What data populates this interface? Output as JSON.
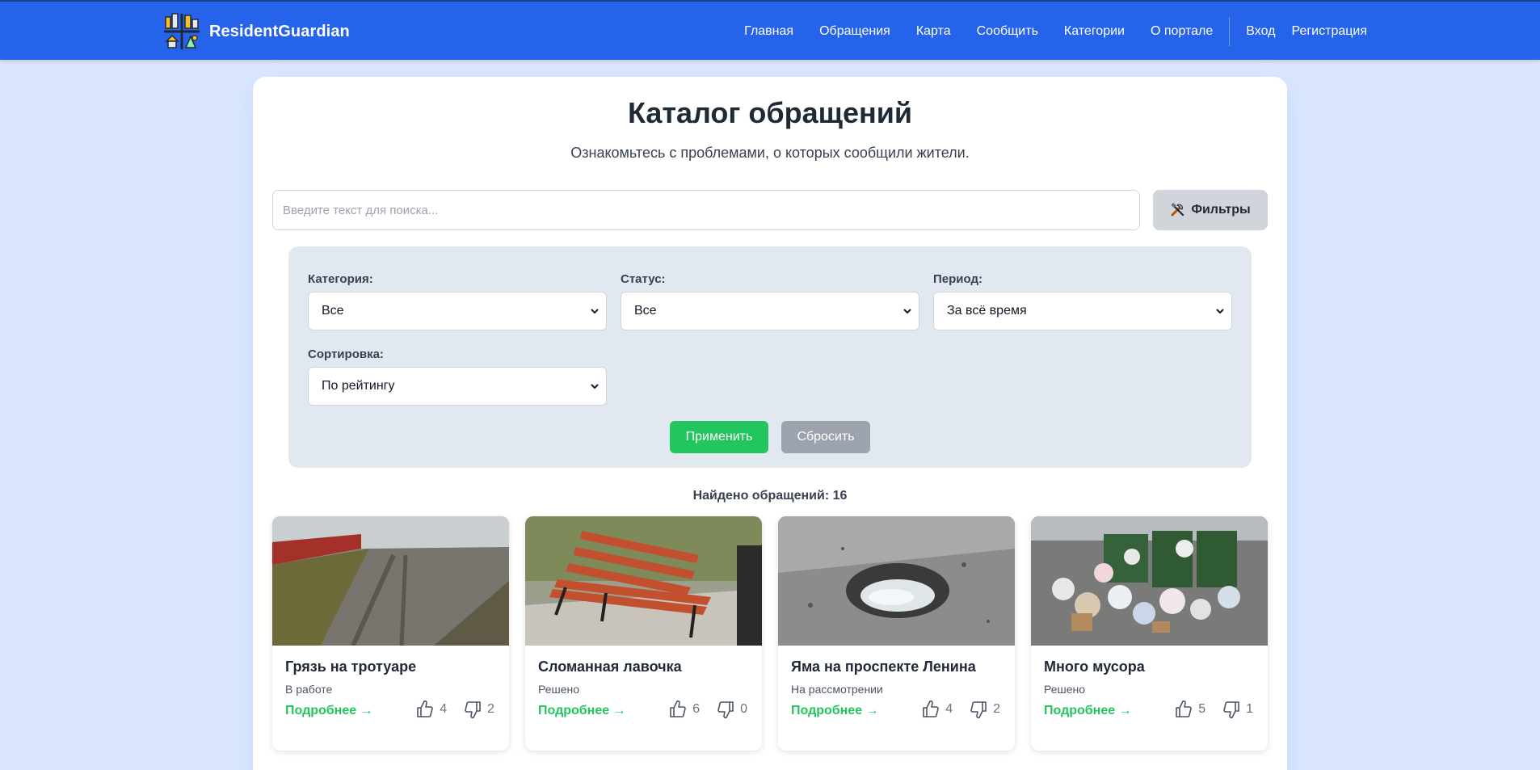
{
  "header": {
    "brand": "ResidentGuardian",
    "nav": [
      "Главная",
      "Обращения",
      "Карта",
      "Сообщить",
      "Категории",
      "О портале"
    ],
    "login": "Вход",
    "register": "Регистрация"
  },
  "main": {
    "title": "Каталог обращений",
    "subtitle": "Ознакомьтесь с проблемами, о которых сообщили жители.",
    "search_placeholder": "Введите текст для поиска...",
    "filters_label": "Фильтры",
    "filters": {
      "category_label": "Категория:",
      "category_value": "Все",
      "status_label": "Статус:",
      "status_value": "Все",
      "period_label": "Период:",
      "period_value": "За всё время",
      "sort_label": "Сортировка:",
      "sort_value": "По рейтингу",
      "apply": "Применить",
      "reset": "Сбросить"
    },
    "found_text": "Найдено обращений: 16"
  },
  "cards": [
    {
      "title": "Грязь на тротуаре",
      "status": "В работе",
      "more": "Подробнее →",
      "likes": "4",
      "dislikes": "2"
    },
    {
      "title": "Сломанная лавочка",
      "status": "Решено",
      "more": "Подробнее →",
      "likes": "6",
      "dislikes": "0"
    },
    {
      "title": "Яма на проспекте Ленина",
      "status": "На рассмотрении",
      "more": "Подробнее →",
      "likes": "4",
      "dislikes": "2"
    },
    {
      "title": "Много мусора",
      "status": "Решено",
      "more": "Подробнее →",
      "likes": "5",
      "dislikes": "1"
    }
  ],
  "colors": {
    "header": "#2563eb",
    "page_bg": "#dbe7ff",
    "apply": "#22c55e",
    "reset": "#9ca3af",
    "link": "#22c55e"
  },
  "icons": [
    "city-logo-icon",
    "tools-icon",
    "chevron-down-icon",
    "thumbs-up-icon",
    "thumbs-down-icon"
  ]
}
